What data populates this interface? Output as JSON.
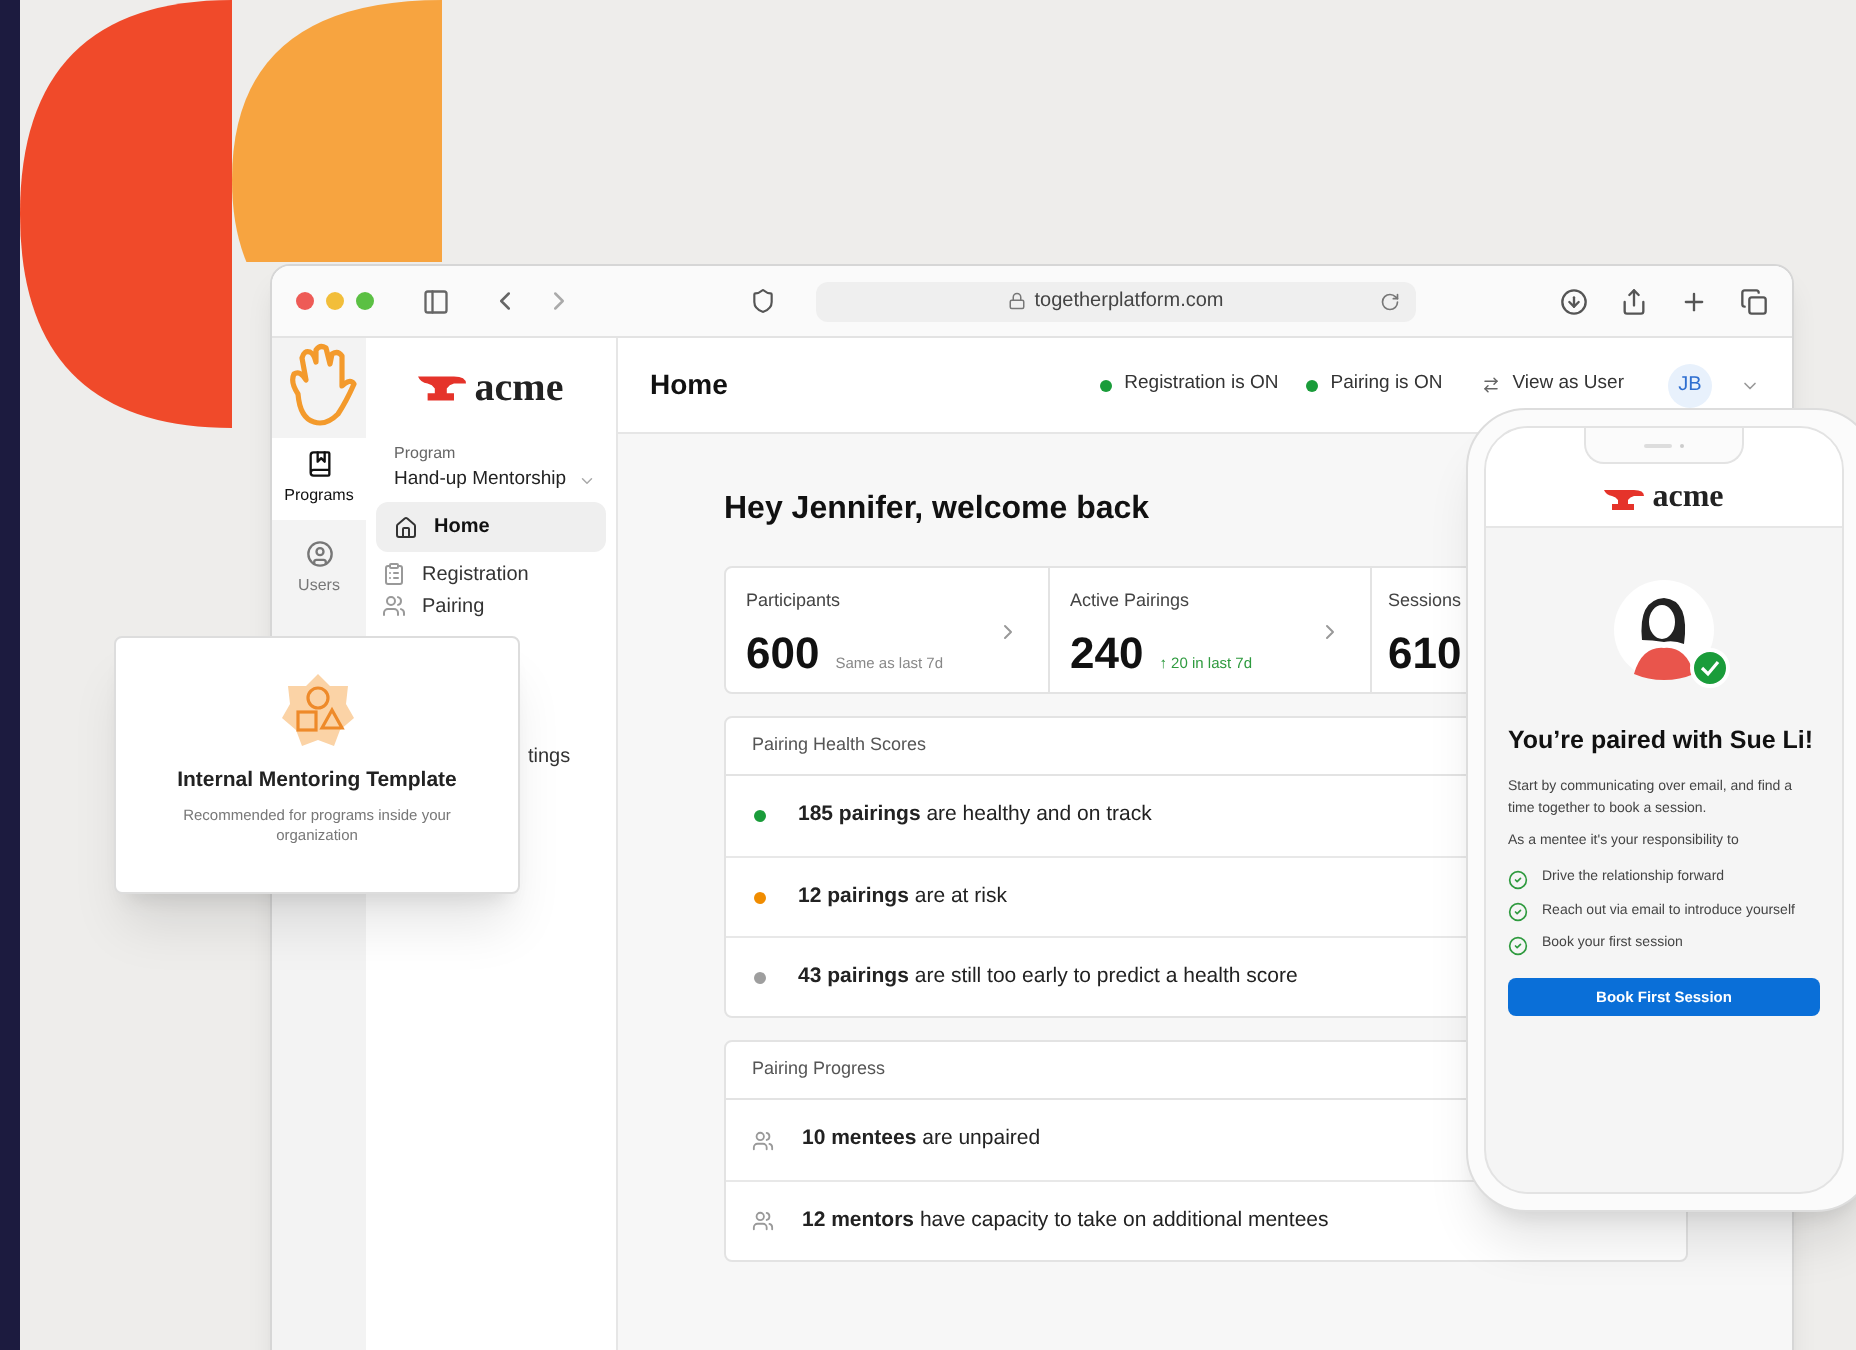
{
  "browser": {
    "url": "togetherplatform.com"
  },
  "rail": [
    {
      "label": "Programs",
      "selected": true
    },
    {
      "label": "Users",
      "selected": false
    }
  ],
  "sidebar": {
    "logo": "acme",
    "program_label": "Program",
    "program": "Hand-up Mentorship",
    "items": [
      {
        "label": "Home",
        "selected": true,
        "kind": "home"
      },
      {
        "label": "Registration",
        "selected": false,
        "kind": "form"
      },
      {
        "label": "Pairing",
        "selected": false,
        "kind": "people"
      },
      {
        "label": "tings",
        "selected": false,
        "kind": "covered"
      }
    ]
  },
  "header": {
    "title": "Home",
    "statuses": [
      {
        "label": "Registration is ON",
        "color": "#1a9c3a"
      },
      {
        "label": "Pairing is ON",
        "color": "#1a9c3a"
      }
    ],
    "view_as": "View as User",
    "avatar": "JB"
  },
  "greeting": "Hey Jennifer, welcome back",
  "stats": [
    {
      "label": "Participants",
      "value": "600",
      "note": "Same as last 7d",
      "color": "#888888"
    },
    {
      "label": "Active Pairings",
      "value": "240",
      "note": "↑ 20 in last 7d",
      "color": "#2e9a3e"
    },
    {
      "label": "Sessions",
      "value": "610"
    }
  ],
  "health": {
    "title": "Pairing Health Scores",
    "rows": [
      {
        "text": "**185 pairings** are healthy and on track",
        "color": "#1a9c3a"
      },
      {
        "text": "**12 pairings** are at risk",
        "color": "#f08c00"
      },
      {
        "text": "**43 pairings** are still too early to predict a health score",
        "color": "#9e9e9e"
      }
    ]
  },
  "progress": {
    "title": "Pairing Progress",
    "rows": [
      "**10 mentees** are unpaired",
      "**12 mentors** have capacity to take on additional mentees"
    ]
  },
  "template_card": {
    "title": "Internal Mentoring Template",
    "subtitle": "Recommended for programs inside your organization"
  },
  "phone": {
    "logo": "acme",
    "heading": "You’re paired with Sue Li!",
    "intro": "Start by communicating over email, and find a time together to book a session.",
    "lead": "As a mentee it's your responsibility to",
    "checklist": [
      "Drive the relationship forward",
      "Reach out via email to introduce yourself",
      "Book your first session"
    ],
    "button": "Book First Session"
  }
}
